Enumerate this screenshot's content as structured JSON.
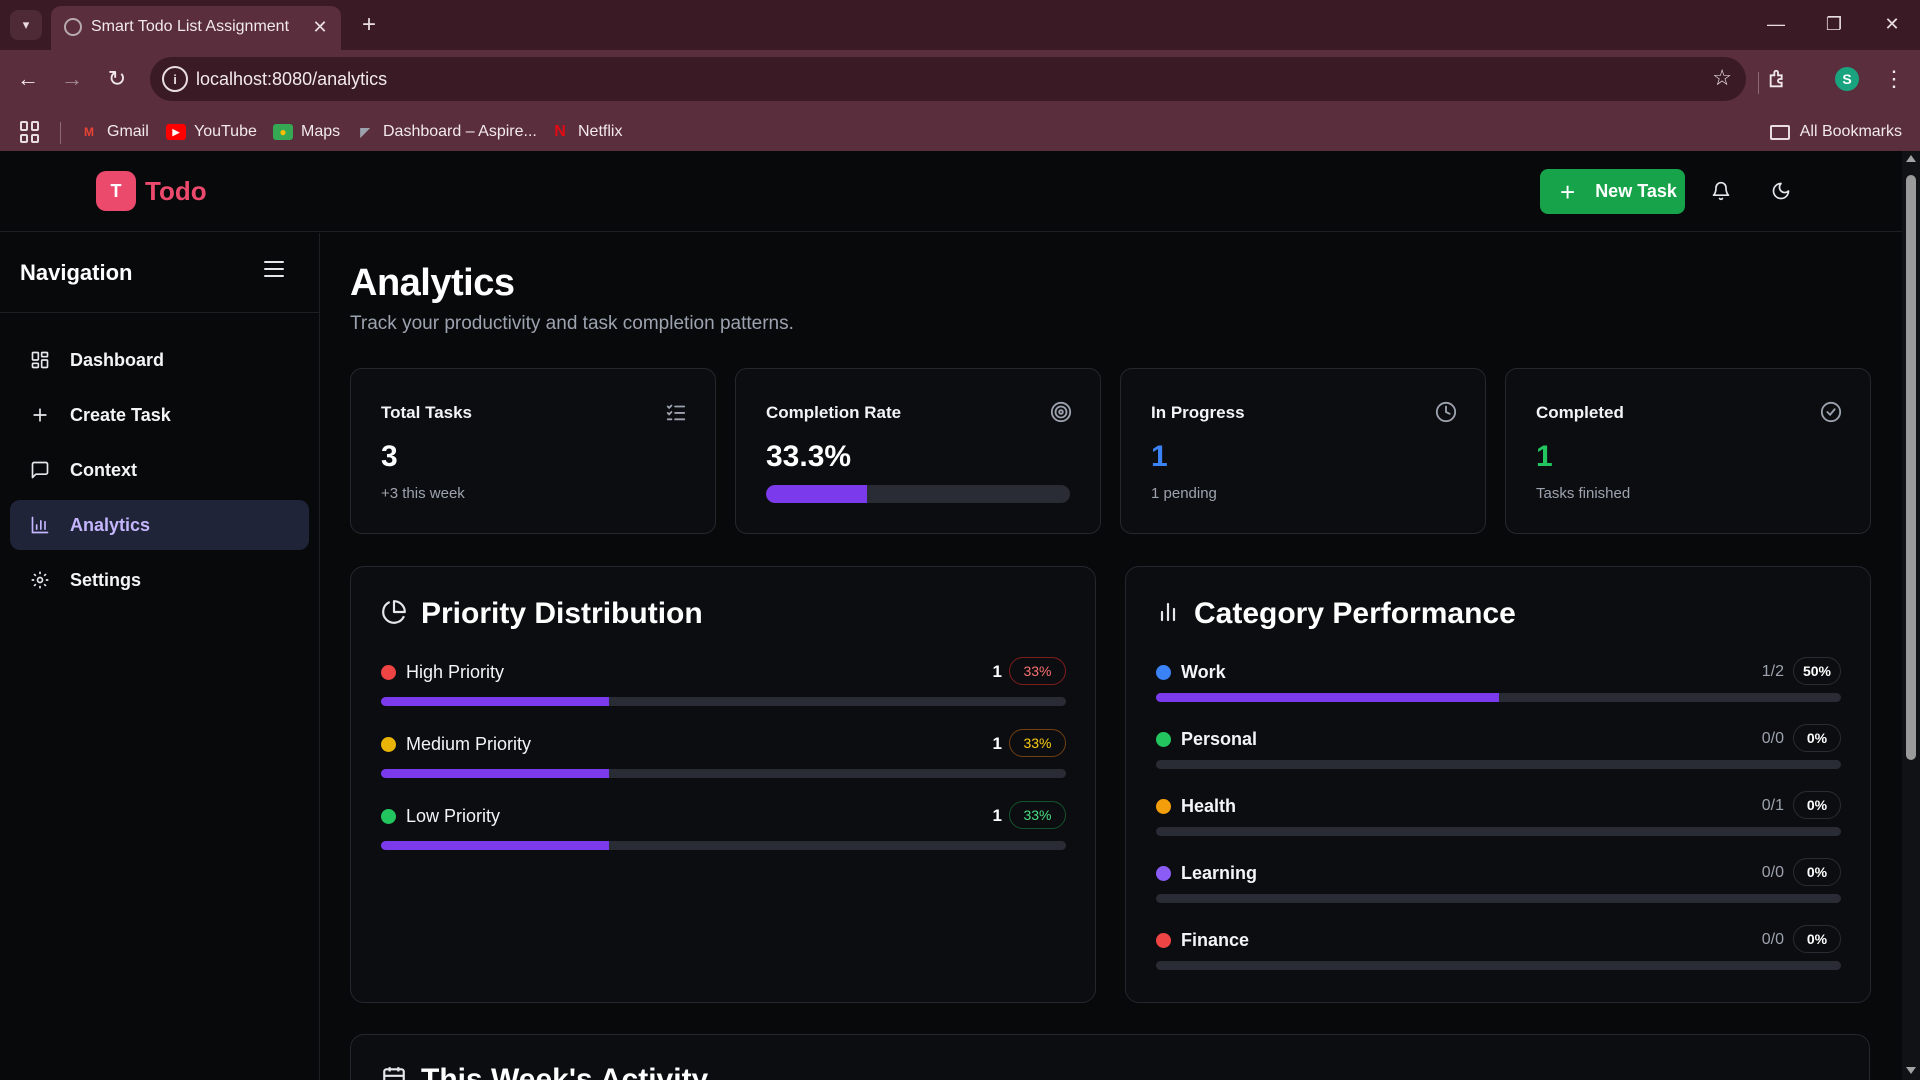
{
  "browser": {
    "tab_title": "Smart Todo List Assignment",
    "url": "localhost:8080/analytics",
    "profile_initial": "S",
    "bookmarks": [
      {
        "label": "Gmail",
        "icon": "gmail-icon"
      },
      {
        "label": "YouTube",
        "icon": "youtube-icon"
      },
      {
        "label": "Maps",
        "icon": "maps-icon"
      },
      {
        "label": "Dashboard – Aspire...",
        "icon": "aspire-icon"
      },
      {
        "label": "Netflix",
        "icon": "netflix-icon"
      }
    ],
    "all_bookmarks": "All Bookmarks"
  },
  "header": {
    "logo_letter": "T",
    "logo_text": "Todo",
    "new_task_label": "New Task"
  },
  "sidebar": {
    "title": "Navigation",
    "items": [
      {
        "label": "Dashboard",
        "icon": "dashboard-grid-icon"
      },
      {
        "label": "Create Task",
        "icon": "plus-icon"
      },
      {
        "label": "Context",
        "icon": "message-icon"
      },
      {
        "label": "Analytics",
        "icon": "bar-chart-icon",
        "active": true
      },
      {
        "label": "Settings",
        "icon": "gear-icon"
      }
    ]
  },
  "page": {
    "title": "Analytics",
    "subtitle": "Track your productivity and task completion patterns."
  },
  "stats": {
    "total": {
      "label": "Total Tasks",
      "value": "3",
      "note": "+3 this week"
    },
    "rate": {
      "label": "Completion Rate",
      "value": "33.3%",
      "progress": 0.333
    },
    "in_progress": {
      "label": "In Progress",
      "value": "1",
      "note": "1 pending"
    },
    "completed": {
      "label": "Completed",
      "value": "1",
      "note": "Tasks finished"
    }
  },
  "priority": {
    "title": "Priority Distribution",
    "rows": [
      {
        "label": "High Priority",
        "count": "1",
        "percent": "33%",
        "fraction": 0.333,
        "color": "#ef4444"
      },
      {
        "label": "Medium Priority",
        "count": "1",
        "percent": "33%",
        "fraction": 0.333,
        "color": "#eab308"
      },
      {
        "label": "Low Priority",
        "count": "1",
        "percent": "33%",
        "fraction": 0.333,
        "color": "#22c55e"
      }
    ]
  },
  "categories": {
    "title": "Category Performance",
    "rows": [
      {
        "label": "Work",
        "ratio": "1/2",
        "percent": "50%",
        "fraction": 0.5,
        "color": "#3b82f6"
      },
      {
        "label": "Personal",
        "ratio": "0/0",
        "percent": "0%",
        "fraction": 0,
        "color": "#22c55e"
      },
      {
        "label": "Health",
        "ratio": "0/1",
        "percent": "0%",
        "fraction": 0,
        "color": "#f59e0b"
      },
      {
        "label": "Learning",
        "ratio": "0/0",
        "percent": "0%",
        "fraction": 0,
        "color": "#8b5cf6"
      },
      {
        "label": "Finance",
        "ratio": "0/0",
        "percent": "0%",
        "fraction": 0,
        "color": "#ef4444"
      }
    ]
  },
  "activity": {
    "title": "This Week's Activity"
  },
  "colors": {
    "accent": "#7c3aed",
    "brand": "#ec4a6d",
    "primary_button": "#16a34a",
    "in_progress": "#3b82f6",
    "completed": "#22c55e"
  }
}
